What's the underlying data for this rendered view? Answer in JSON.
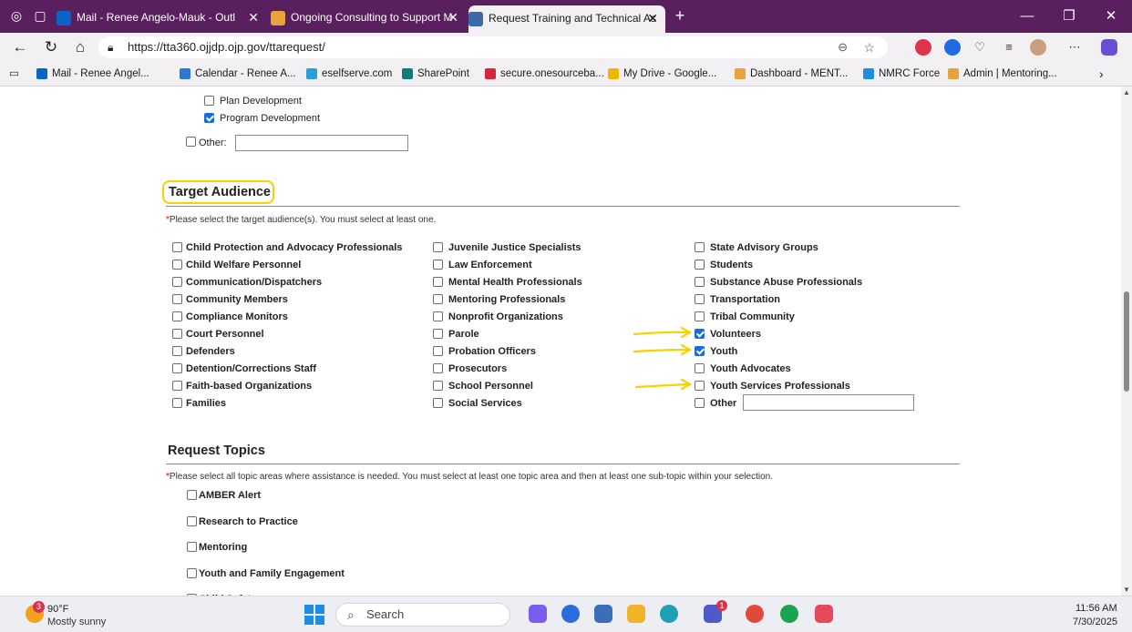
{
  "browser": {
    "tabs": [
      {
        "title": "Mail - Renee Angelo-Mauk - Outl"
      },
      {
        "title": "Ongoing Consulting to Support M"
      },
      {
        "title": "Request Training and Technical As"
      }
    ],
    "new_tab_label": "+",
    "url": "https://tta360.ojjdp.ojp.gov/ttarequest/",
    "bookmarks": [
      "Mail - Renee Angel...",
      "Calendar - Renee A...",
      "eselfserve.com",
      "SharePoint",
      "secure.onesourceba...",
      "My Drive - Google...",
      "Dashboard - MENT...",
      "NMRC Force",
      "Admin | Mentoring..."
    ]
  },
  "form": {
    "prev_items": [
      {
        "label": "Plan Development",
        "checked": false
      },
      {
        "label": "Program Development",
        "checked": true
      }
    ],
    "prev_other_label": "Other:",
    "target_audience": {
      "heading": "Target Audience",
      "instruction_marker": "*",
      "instruction": "Please select the target audience(s). You must select at least one.",
      "col1": [
        {
          "label": "Child Protection and Advocacy Professionals",
          "checked": false
        },
        {
          "label": "Child Welfare Personnel",
          "checked": false
        },
        {
          "label": "Communication/Dispatchers",
          "checked": false
        },
        {
          "label": "Community Members",
          "checked": false
        },
        {
          "label": "Compliance Monitors",
          "checked": false
        },
        {
          "label": "Court Personnel",
          "checked": false
        },
        {
          "label": "Defenders",
          "checked": false
        },
        {
          "label": "Detention/Corrections Staff",
          "checked": false
        },
        {
          "label": "Faith-based Organizations",
          "checked": false
        },
        {
          "label": "Families",
          "checked": false
        }
      ],
      "col2": [
        {
          "label": "Juvenile Justice Specialists",
          "checked": false
        },
        {
          "label": "Law Enforcement",
          "checked": false
        },
        {
          "label": "Mental Health Professionals",
          "checked": false
        },
        {
          "label": "Mentoring Professionals",
          "checked": false
        },
        {
          "label": "Nonprofit Organizations",
          "checked": false
        },
        {
          "label": "Parole",
          "checked": false
        },
        {
          "label": "Probation Officers",
          "checked": false
        },
        {
          "label": "Prosecutors",
          "checked": false
        },
        {
          "label": "School Personnel",
          "checked": false
        },
        {
          "label": "Social Services",
          "checked": false
        }
      ],
      "col3": [
        {
          "label": "State Advisory Groups",
          "checked": false
        },
        {
          "label": "Students",
          "checked": false
        },
        {
          "label": "Substance Abuse Professionals",
          "checked": false
        },
        {
          "label": "Transportation",
          "checked": false
        },
        {
          "label": "Tribal Community",
          "checked": false
        },
        {
          "label": "Volunteers",
          "checked": true
        },
        {
          "label": "Youth",
          "checked": true
        },
        {
          "label": "Youth Advocates",
          "checked": false
        },
        {
          "label": "Youth Services Professionals",
          "checked": false
        },
        {
          "label": "Other",
          "checked": false
        }
      ]
    },
    "request_topics": {
      "heading": "Request Topics",
      "instruction_marker": "*",
      "instruction": "Please select all topic areas where assistance is needed. You must select at least one topic area and then at least one sub-topic within your selection.",
      "items": [
        {
          "label": "AMBER Alert",
          "checked": false
        },
        {
          "label": "Research to Practice",
          "checked": false
        },
        {
          "label": "Mentoring",
          "checked": false
        },
        {
          "label": "Youth and Family Engagement",
          "checked": false
        },
        {
          "label": "Child Safety",
          "checked": false
        }
      ]
    }
  },
  "annotation_color": "#f7d100",
  "taskbar": {
    "weather_temp": "90°F",
    "weather_desc": "Mostly sunny",
    "weather_badge": "3",
    "search_label": "Search",
    "teams_badge": "1",
    "time": "11:56 AM",
    "date": "7/30/2025"
  }
}
